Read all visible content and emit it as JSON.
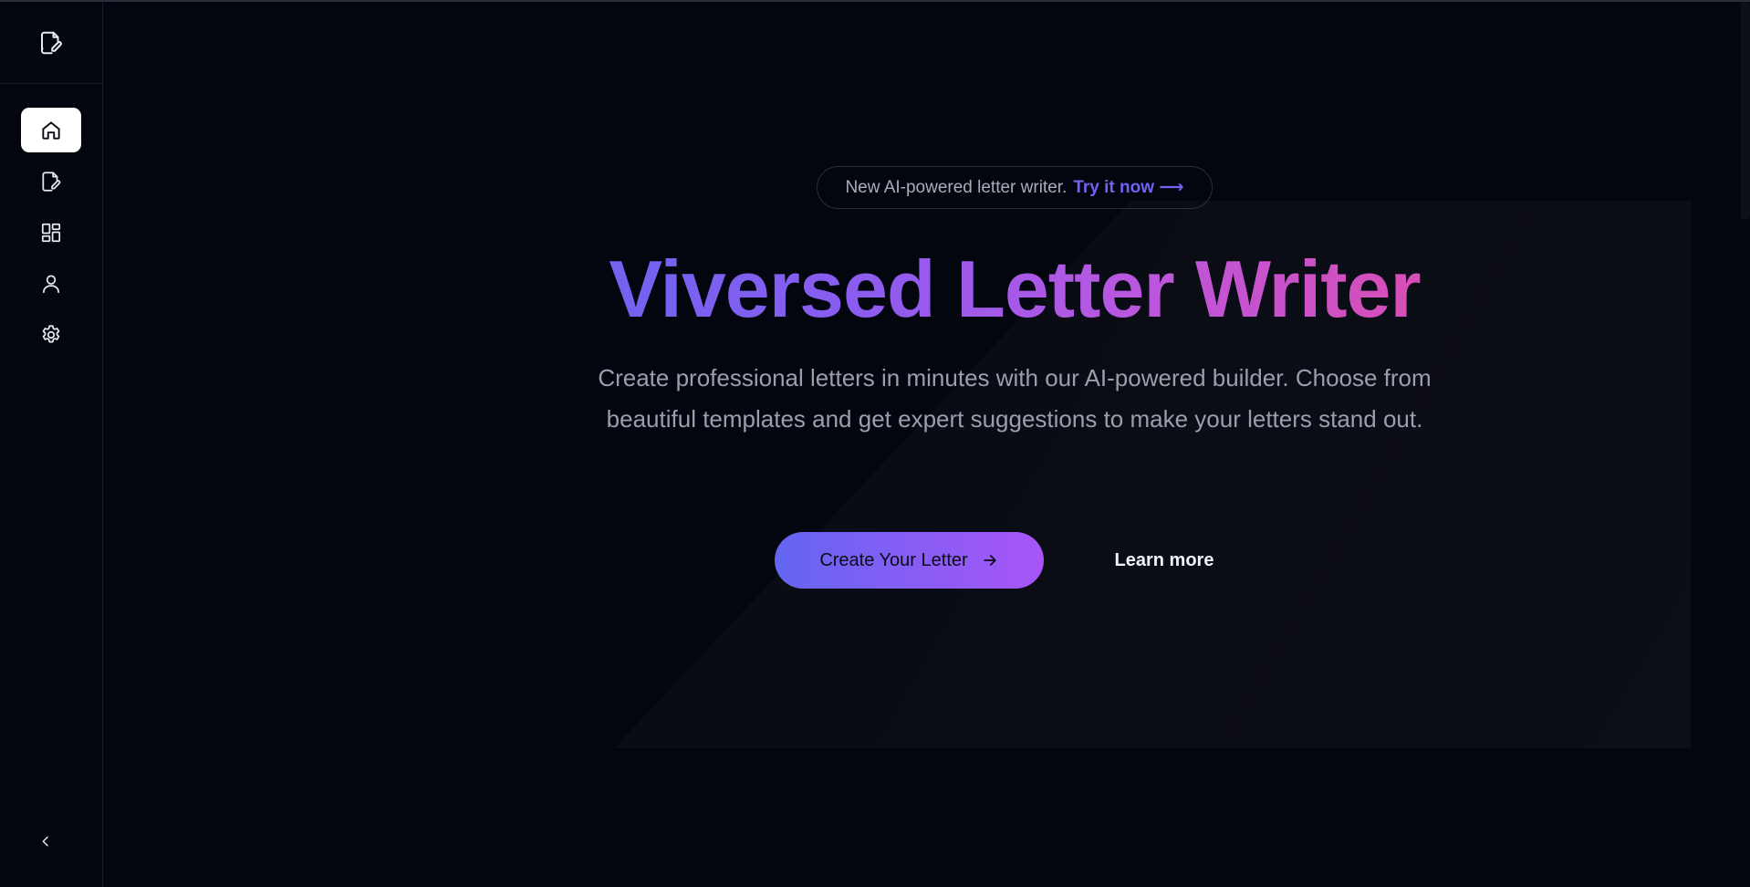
{
  "sidebar": {
    "logo_icon": "file-edit-icon",
    "items": [
      {
        "name": "home",
        "icon": "home-icon",
        "active": true
      },
      {
        "name": "editor",
        "icon": "file-edit-icon",
        "active": false
      },
      {
        "name": "templates",
        "icon": "dashboard-icon",
        "active": false
      },
      {
        "name": "profile",
        "icon": "user-icon",
        "active": false
      },
      {
        "name": "settings",
        "icon": "gear-icon",
        "active": false
      }
    ],
    "collapse_icon": "chevron-left-icon"
  },
  "announcement": {
    "text": "New AI-powered letter writer.",
    "link_text": "Try it now ⟶"
  },
  "hero": {
    "title": "Viversed Letter Writer",
    "subtitle": "Create professional letters in minutes with our AI-powered builder. Choose from beautiful templates and get expert suggestions to make your letters stand out.",
    "primary_cta": "Create Your Letter",
    "secondary_cta": "Learn more"
  },
  "colors": {
    "background": "#04060f",
    "accent": "#6f63f1",
    "gradient_start": "#6366f1",
    "gradient_end": "#e64aa2"
  }
}
